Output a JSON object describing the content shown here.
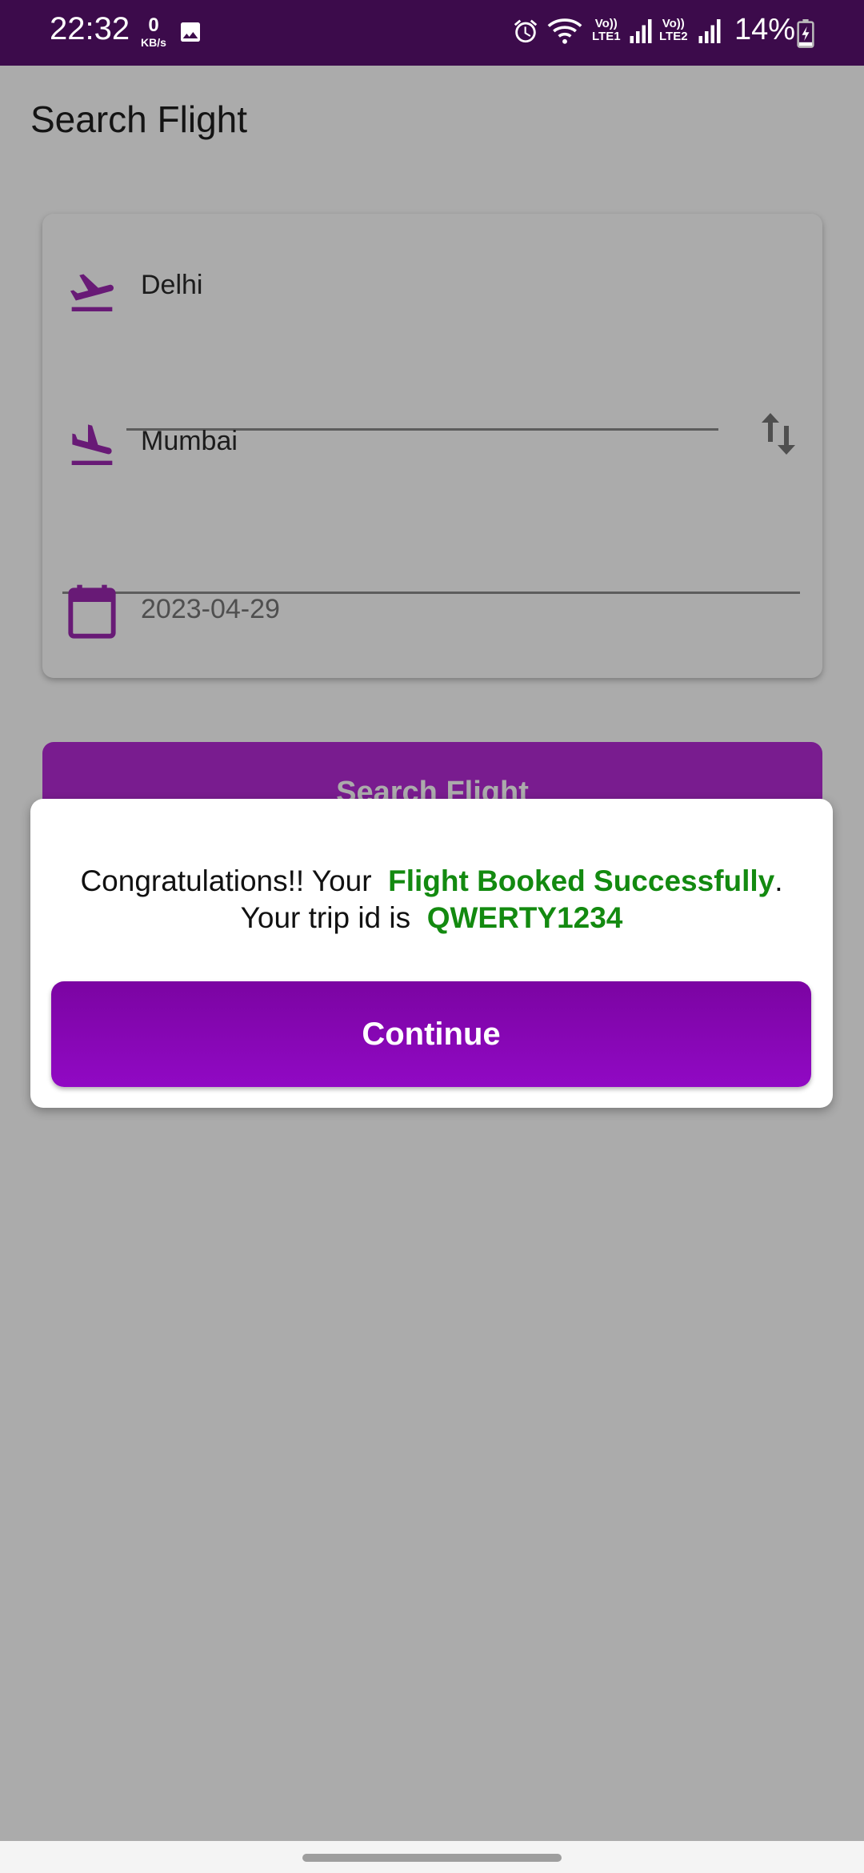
{
  "status_bar": {
    "time": "22:32",
    "net_speed_value": "0",
    "net_speed_unit": "KB/s",
    "sim1_label": "Vo))\nLTE1",
    "sim2_label": "Vo))\nLTE2",
    "battery_percent": "14%",
    "icons": [
      "gallery-icon",
      "alarm-icon",
      "wifi-icon",
      "signal-icon",
      "signal-icon",
      "battery-charging-icon"
    ]
  },
  "page": {
    "title": "Search Flight"
  },
  "search_form": {
    "from_value": "Delhi",
    "to_value": "Mumbai",
    "date_value": "2023-04-29",
    "icons": [
      "flight-takeoff-icon",
      "flight-land-icon",
      "calendar-icon",
      "swap-vertical-icon"
    ],
    "accent_color": "#9c27b0"
  },
  "search_button": {
    "label": "Search Flight"
  },
  "dialog": {
    "msg_prefix": "Congratulations!! Your ",
    "msg_highlight": "Flight Booked Successfully",
    "msg_period": ".",
    "trip_prefix": "Your trip id is ",
    "trip_id": "QWERTY1234",
    "highlight_color": "#138a10",
    "continue_label": "Continue",
    "button_color": "#8a06b8"
  }
}
